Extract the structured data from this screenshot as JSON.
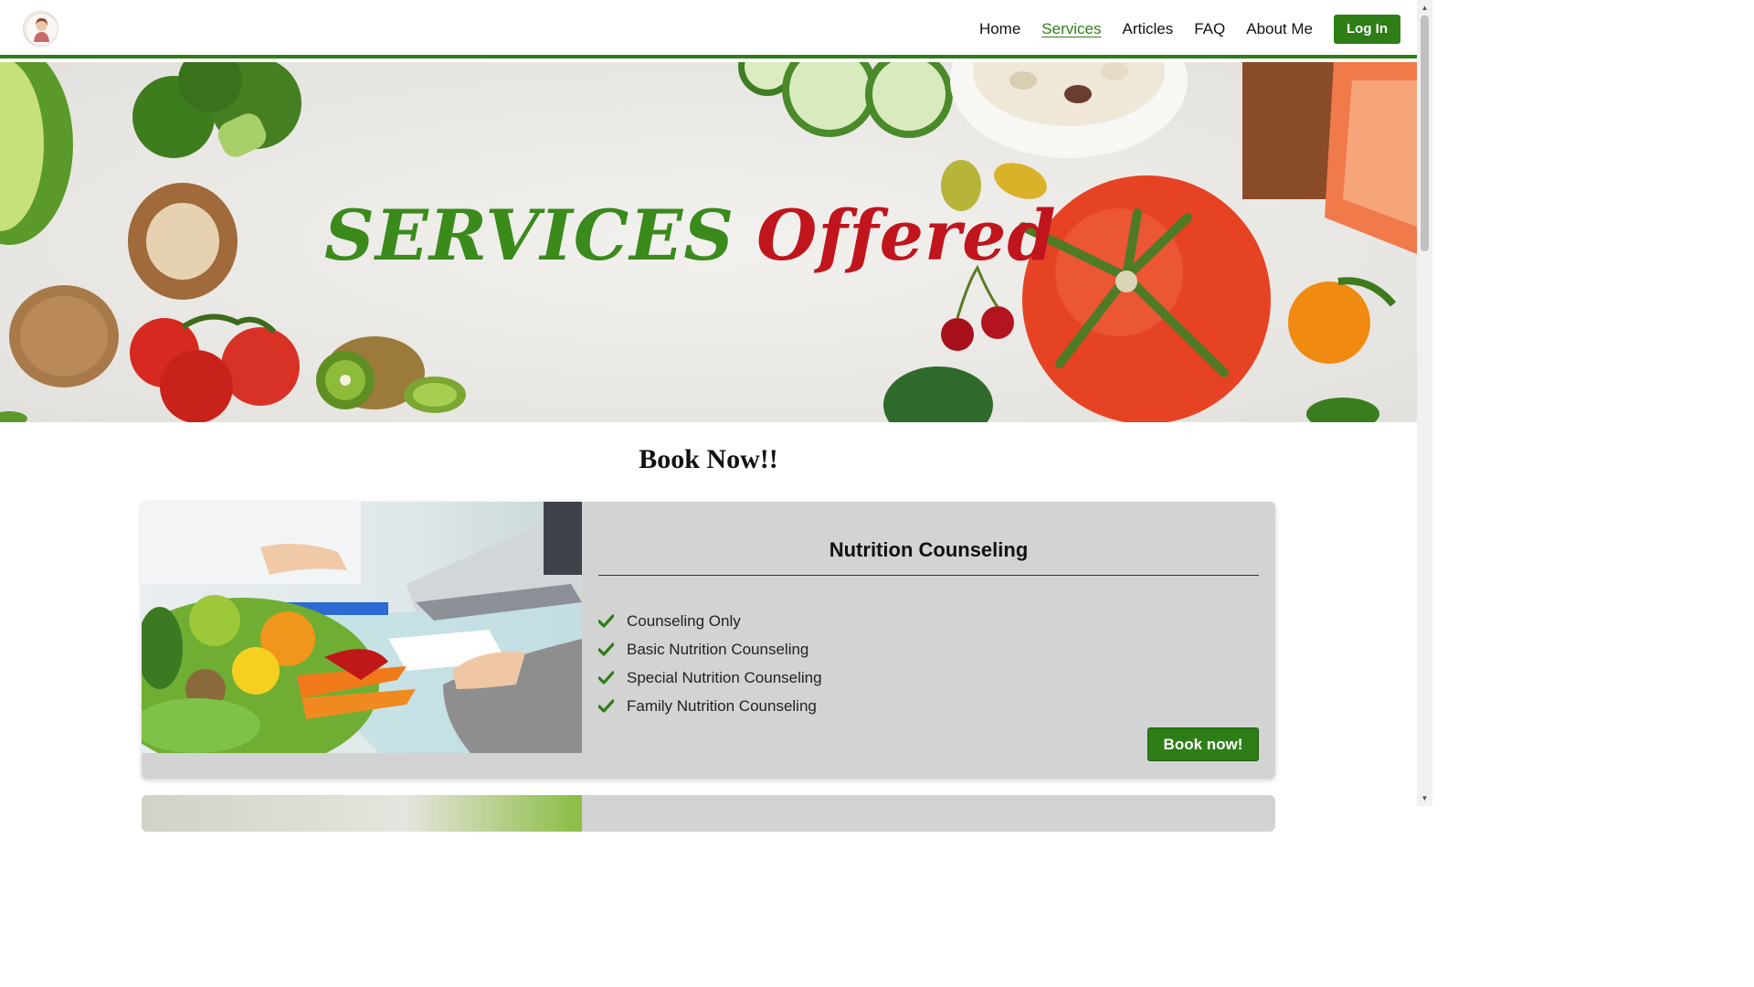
{
  "header": {
    "logo_icon": "nutritionist-portrait-logo",
    "nav": [
      {
        "label": "Home",
        "active": false
      },
      {
        "label": "Services",
        "active": true
      },
      {
        "label": "Articles",
        "active": false
      },
      {
        "label": "FAQ",
        "active": false
      },
      {
        "label": "About Me",
        "active": false
      }
    ],
    "login_label": "Log In"
  },
  "hero": {
    "title_part1": "SERVICES",
    "title_part2": "Offered"
  },
  "booking": {
    "heading": "Book Now!!",
    "cards": [
      {
        "title": "Nutrition Counseling",
        "features": [
          "Counseling Only",
          "Basic Nutrition Counseling",
          "Special Nutrition Counseling",
          "Family Nutrition Counseling"
        ],
        "button_label": "Book now!"
      }
    ]
  },
  "colors": {
    "brand_green": "#2e7d17",
    "accent_red": "#c0151c",
    "card_bg": "#d3d3d3"
  }
}
